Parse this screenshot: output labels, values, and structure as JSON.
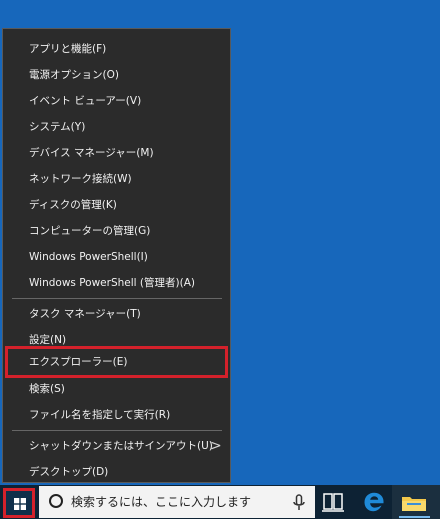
{
  "menu": {
    "items": [
      {
        "label": "アプリと機能(F)"
      },
      {
        "label": "電源オプション(O)"
      },
      {
        "label": "イベント ビューアー(V)"
      },
      {
        "label": "システム(Y)"
      },
      {
        "label": "デバイス マネージャー(M)"
      },
      {
        "label": "ネットワーク接続(W)"
      },
      {
        "label": "ディスクの管理(K)"
      },
      {
        "label": "コンピューターの管理(G)"
      },
      {
        "label": "Windows PowerShell(I)"
      },
      {
        "label": "Windows PowerShell (管理者)(A)"
      },
      {
        "label": "タスク マネージャー(T)"
      },
      {
        "label": "設定(N)"
      },
      {
        "label": "エクスプローラー(E)"
      },
      {
        "label": "検索(S)"
      },
      {
        "label": "ファイル名を指定して実行(R)"
      },
      {
        "label": "シャットダウンまたはサインアウト(U)"
      },
      {
        "label": "デスクトップ(D)"
      }
    ],
    "submenu_arrow": ">"
  },
  "taskbar": {
    "search_placeholder": "検索するには、ここに入力します"
  },
  "icons": {
    "start": "windows-logo-icon",
    "search": "search-circle-icon",
    "mic": "microphone-icon",
    "task_view": "task-view-icon",
    "browser": "edge-icon",
    "explorer": "folder-icon"
  },
  "colors": {
    "desktop": "#1767bb",
    "menu_background": "#2b2b2b",
    "highlight_border": "#d4212b",
    "taskbar": "#0d2234",
    "edge": "#1f8ad8",
    "folder": "#f3c84b"
  }
}
